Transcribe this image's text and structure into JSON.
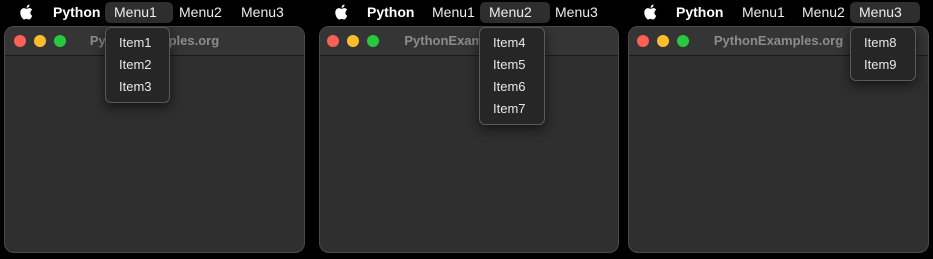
{
  "panels": [
    {
      "menubar": {
        "app": "Python",
        "menus": [
          "Menu1",
          "Menu2",
          "Menu3"
        ],
        "active_menu": "Menu1"
      },
      "window": {
        "title": "PythonExamples.org"
      },
      "dropdown": {
        "items": [
          "Item1",
          "Item2",
          "Item3"
        ]
      }
    },
    {
      "menubar": {
        "app": "Python",
        "menus": [
          "Menu1",
          "Menu2",
          "Menu3"
        ],
        "active_menu": "Menu2"
      },
      "window": {
        "title": "PythonExamples.org"
      },
      "dropdown": {
        "items": [
          "Item4",
          "Item5",
          "Item6",
          "Item7"
        ]
      }
    },
    {
      "menubar": {
        "app": "Python",
        "menus": [
          "Menu1",
          "Menu2",
          "Menu3"
        ],
        "active_menu": "Menu3"
      },
      "window": {
        "title": "PythonExamples.org"
      },
      "dropdown": {
        "items": [
          "Item8",
          "Item9"
        ]
      }
    }
  ],
  "colors": {
    "background": "#000000",
    "window": "#2f2f2f",
    "close": "#fe5f57",
    "minimize": "#febc2e",
    "maximize": "#28c840",
    "active_menu": "#2e2e2e"
  },
  "icons": [
    "apple-icon"
  ]
}
